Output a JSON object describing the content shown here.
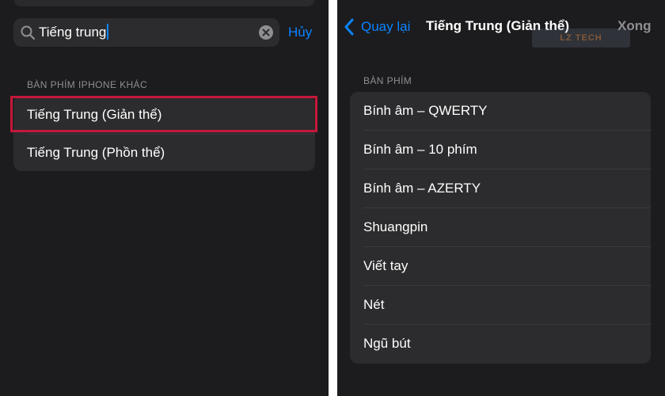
{
  "left": {
    "search": {
      "value": "Tiếng trung",
      "cancel_label": "Hủy"
    },
    "section_header": "BÀN PHÍM IPHONE KHÁC",
    "items": [
      {
        "label": "Tiếng Trung (Giản thể)",
        "highlighted": true
      },
      {
        "label": "Tiếng Trung (Phồn thể)",
        "highlighted": false
      }
    ],
    "highlight_color": "#c4183a"
  },
  "right": {
    "nav": {
      "back_label": "Quay lại",
      "title": "Tiếng Trung (Giản thể)",
      "done_label": "Xong"
    },
    "watermark": "LZ TECH",
    "section_header": "BÀN PHÍM",
    "items": [
      {
        "label": "Bính âm – QWERTY"
      },
      {
        "label": "Bính âm – 10 phím"
      },
      {
        "label": "Bính âm – AZERTY"
      },
      {
        "label": "Shuangpin"
      },
      {
        "label": "Viết tay"
      },
      {
        "label": "Nét"
      },
      {
        "label": "Ngũ bút"
      }
    ]
  },
  "colors": {
    "background": "#1c1c1e",
    "cell": "#2c2c2e",
    "accent": "#0a84ff",
    "secondary_text": "#8e8e93"
  }
}
